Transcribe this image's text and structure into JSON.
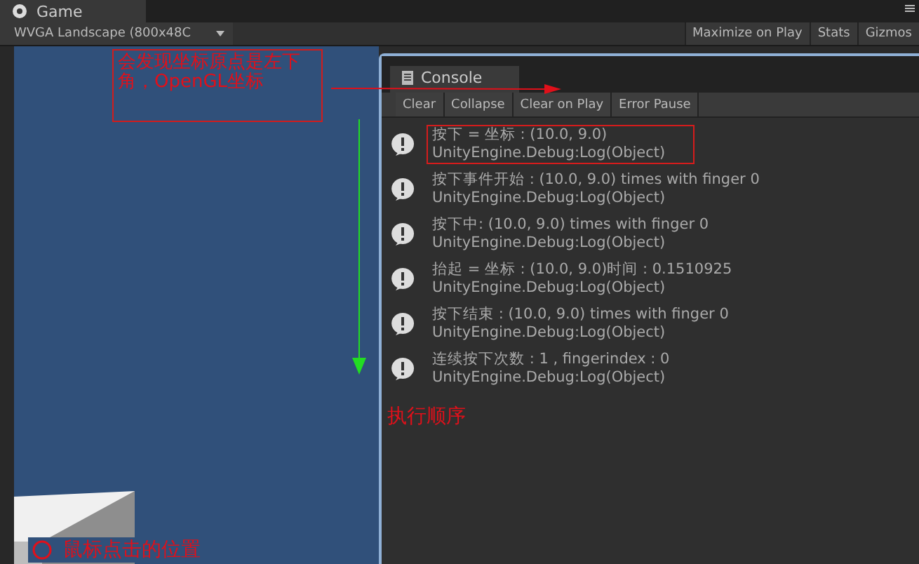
{
  "window": {
    "tab": "Game"
  },
  "toolbar": {
    "resolution": "WVGA Landscape (800x48C",
    "buttons": [
      {
        "label": "Maximize on Play"
      },
      {
        "label": "Stats"
      },
      {
        "label": "Gizmos"
      }
    ]
  },
  "console": {
    "title": "Console",
    "buttons": [
      {
        "label": "Clear"
      },
      {
        "label": "Collapse"
      },
      {
        "label": "Clear on Play"
      },
      {
        "label": "Error Pause"
      }
    ],
    "entries": [
      {
        "message": " 按下 = 坐标 : (10.0, 9.0)",
        "source": "UnityEngine.Debug:Log(Object)",
        "highlighted": true
      },
      {
        "message": "按下事件开始 : (10.0, 9.0) times with finger 0",
        "source": "UnityEngine.Debug:Log(Object)",
        "highlighted": false
      },
      {
        "message": "按下中: (10.0, 9.0) times with finger 0",
        "source": "UnityEngine.Debug:Log(Object)",
        "highlighted": false
      },
      {
        "message": " 抬起 = 坐标 : (10.0, 9.0)时间 : 0.1510925",
        "source": "UnityEngine.Debug:Log(Object)",
        "highlighted": false
      },
      {
        "message": "按下结束 : (10.0, 9.0) times with finger 0",
        "source": "UnityEngine.Debug:Log(Object)",
        "highlighted": false
      },
      {
        "message": "连续按下次数 :  1  , fingerindex :  0",
        "source": "UnityEngine.Debug:Log(Object)",
        "highlighted": false
      }
    ]
  },
  "annotations": {
    "origin_note": "会发现坐标原点是左下角，OpenGL坐标",
    "order_note": "执行顺序",
    "click_note": "鼠标点击的位置"
  }
}
